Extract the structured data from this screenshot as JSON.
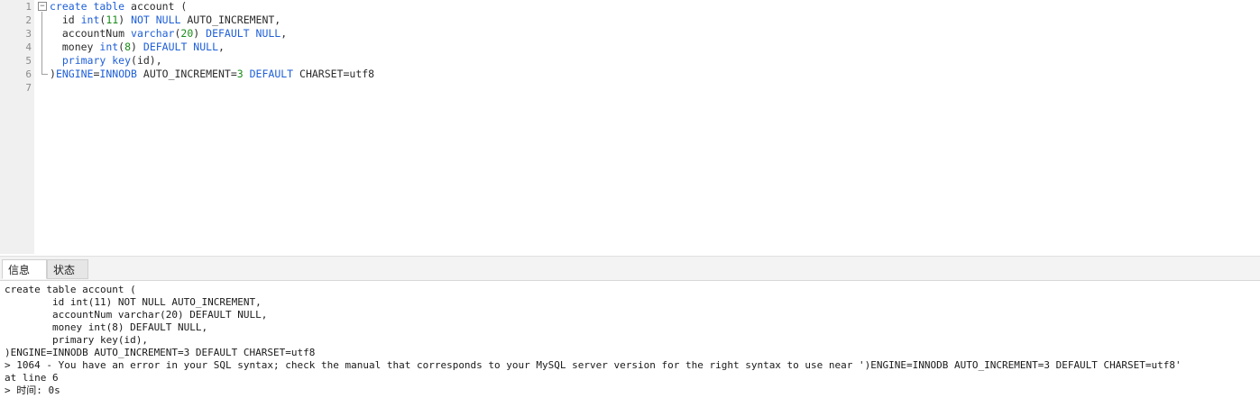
{
  "editor": {
    "line_numbers": [
      "1",
      "2",
      "3",
      "4",
      "5",
      "6",
      "7"
    ],
    "lines": [
      {
        "segments": [
          {
            "t": "create table",
            "k": "kw"
          },
          {
            "t": " account (",
            "k": "plain"
          }
        ]
      },
      {
        "segments": [
          {
            "t": "  id ",
            "k": "plain"
          },
          {
            "t": "int",
            "k": "kw"
          },
          {
            "t": "(",
            "k": "plain"
          },
          {
            "t": "11",
            "k": "num"
          },
          {
            "t": ") ",
            "k": "plain"
          },
          {
            "t": "NOT NULL",
            "k": "kw"
          },
          {
            "t": " AUTO_INCREMENT,",
            "k": "plain"
          }
        ]
      },
      {
        "segments": [
          {
            "t": "  accountNum ",
            "k": "plain"
          },
          {
            "t": "varchar",
            "k": "kw"
          },
          {
            "t": "(",
            "k": "plain"
          },
          {
            "t": "20",
            "k": "num"
          },
          {
            "t": ") ",
            "k": "plain"
          },
          {
            "t": "DEFAULT NULL",
            "k": "kw"
          },
          {
            "t": ",",
            "k": "plain"
          }
        ]
      },
      {
        "segments": [
          {
            "t": "  money ",
            "k": "plain"
          },
          {
            "t": "int",
            "k": "kw"
          },
          {
            "t": "(",
            "k": "plain"
          },
          {
            "t": "8",
            "k": "num"
          },
          {
            "t": ") ",
            "k": "plain"
          },
          {
            "t": "DEFAULT NULL",
            "k": "kw"
          },
          {
            "t": ",",
            "k": "plain"
          }
        ]
      },
      {
        "segments": [
          {
            "t": "  ",
            "k": "plain"
          },
          {
            "t": "primary key",
            "k": "kw"
          },
          {
            "t": "(id),",
            "k": "plain"
          }
        ]
      },
      {
        "segments": [
          {
            "t": ")",
            "k": "plain"
          },
          {
            "t": "ENGINE",
            "k": "kw"
          },
          {
            "t": "=",
            "k": "plain"
          },
          {
            "t": "INNODB",
            "k": "kw"
          },
          {
            "t": " AUTO_INCREMENT=",
            "k": "plain"
          },
          {
            "t": "3",
            "k": "num"
          },
          {
            "t": " ",
            "k": "plain"
          },
          {
            "t": "DEFAULT",
            "k": "kw"
          },
          {
            "t": " CHARSET=utf8",
            "k": "plain"
          }
        ]
      },
      {
        "segments": []
      }
    ]
  },
  "tabs": {
    "info": "信息",
    "status": "状态"
  },
  "output": {
    "lines": [
      "create table account (",
      "        id int(11) NOT NULL AUTO_INCREMENT,",
      "        accountNum varchar(20) DEFAULT NULL,",
      "        money int(8) DEFAULT NULL,",
      "        primary key(id),",
      ")ENGINE=INNODB AUTO_INCREMENT=3 DEFAULT CHARSET=utf8",
      "> 1064 - You have an error in your SQL syntax; check the manual that corresponds to your MySQL server version for the right syntax to use near ')ENGINE=INNODB AUTO_INCREMENT=3 DEFAULT CHARSET=utf8'",
      "at line 6",
      "> 时间: 0s"
    ]
  }
}
